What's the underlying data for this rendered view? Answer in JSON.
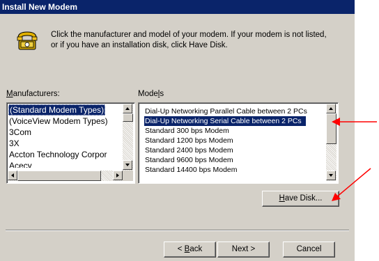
{
  "dialog": {
    "title": "Install New Modem",
    "intro_line1": "Click the manufacturer and model of your modem. If your modem is not listed,",
    "intro_line2": "or if you have an installation disk, click Have Disk."
  },
  "manufacturers": {
    "label_key": "M",
    "label_rest": "anufacturers:",
    "items": [
      "(Standard Modem Types)",
      "(VoiceView Modem Types)",
      "3Com",
      "3X",
      "Accton Technology Corpor",
      "Acecy"
    ],
    "selected_index": 0
  },
  "models": {
    "label_start": "Mode",
    "label_key": "l",
    "label_end": "s",
    "items": [
      "Dial-Up Networking Parallel Cable between 2 PCs",
      "Dial-Up Networking Serial Cable between 2 PCs",
      "Standard 300 bps Modem",
      "Standard 1200 bps Modem",
      "Standard 2400 bps Modem",
      "Standard 9600 bps Modem",
      "Standard 14400 bps Modem"
    ],
    "selected_index": 1
  },
  "buttons": {
    "have_disk_key": "H",
    "have_disk_rest": "ave Disk...",
    "back_prefix": "< ",
    "back_key": "B",
    "back_rest": "ack",
    "next": "Next >",
    "cancel": "Cancel"
  },
  "colors": {
    "dialog_face": "#d4d0c8",
    "title_bar": "#0a246a",
    "selection": "#0a246a",
    "annotation_arrow": "#ff0000"
  },
  "icons": {
    "dialog_icon": "telephone-icon",
    "annotations": [
      "red-arrow-icon",
      "red-arrow-icon"
    ]
  }
}
